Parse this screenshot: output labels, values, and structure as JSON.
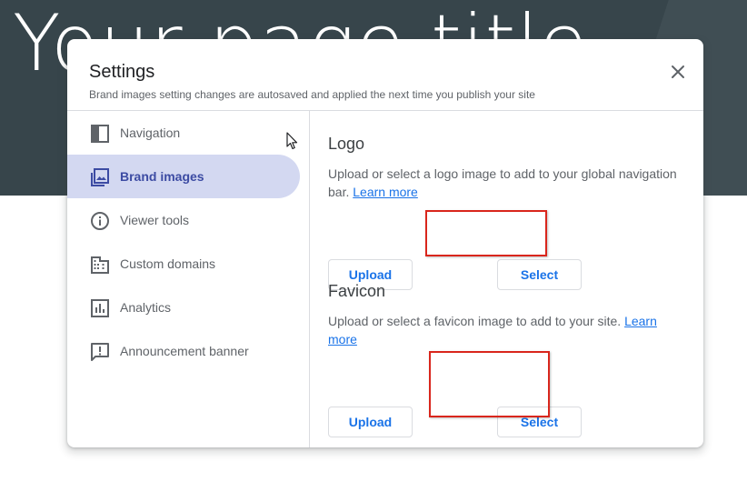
{
  "page": {
    "title": "Your page title"
  },
  "dialog": {
    "title": "Settings",
    "subtitle": "Brand images setting changes are autosaved and applied the next time you publish your site",
    "close_icon": "close-icon"
  },
  "sidebar": {
    "items": [
      {
        "label": "Navigation",
        "icon": "navigation-panel-icon",
        "active": false
      },
      {
        "label": "Brand images",
        "icon": "image-icon",
        "active": true
      },
      {
        "label": "Viewer tools",
        "icon": "info-icon",
        "active": false
      },
      {
        "label": "Custom domains",
        "icon": "building-icon",
        "active": false
      },
      {
        "label": "Analytics",
        "icon": "bar-chart-icon",
        "active": false
      },
      {
        "label": "Announcement banner",
        "icon": "announcement-icon",
        "active": false
      }
    ]
  },
  "logo": {
    "title": "Logo",
    "description": "Upload or select a logo image to add to your global navigation bar.",
    "learn_more": "Learn more",
    "upload_label": "Upload",
    "select_label": "Select"
  },
  "favicon": {
    "title": "Favicon",
    "description": "Upload or select a favicon image to add to your site.",
    "learn_more": "Learn more",
    "upload_label": "Upload",
    "select_label": "Select"
  },
  "colors": {
    "accent": "#1a73e8",
    "active_nav_bg": "#d3d8f1",
    "active_nav_text": "#3c4ba3",
    "highlight": "#d9261c",
    "banner_bg": "#37454b"
  }
}
